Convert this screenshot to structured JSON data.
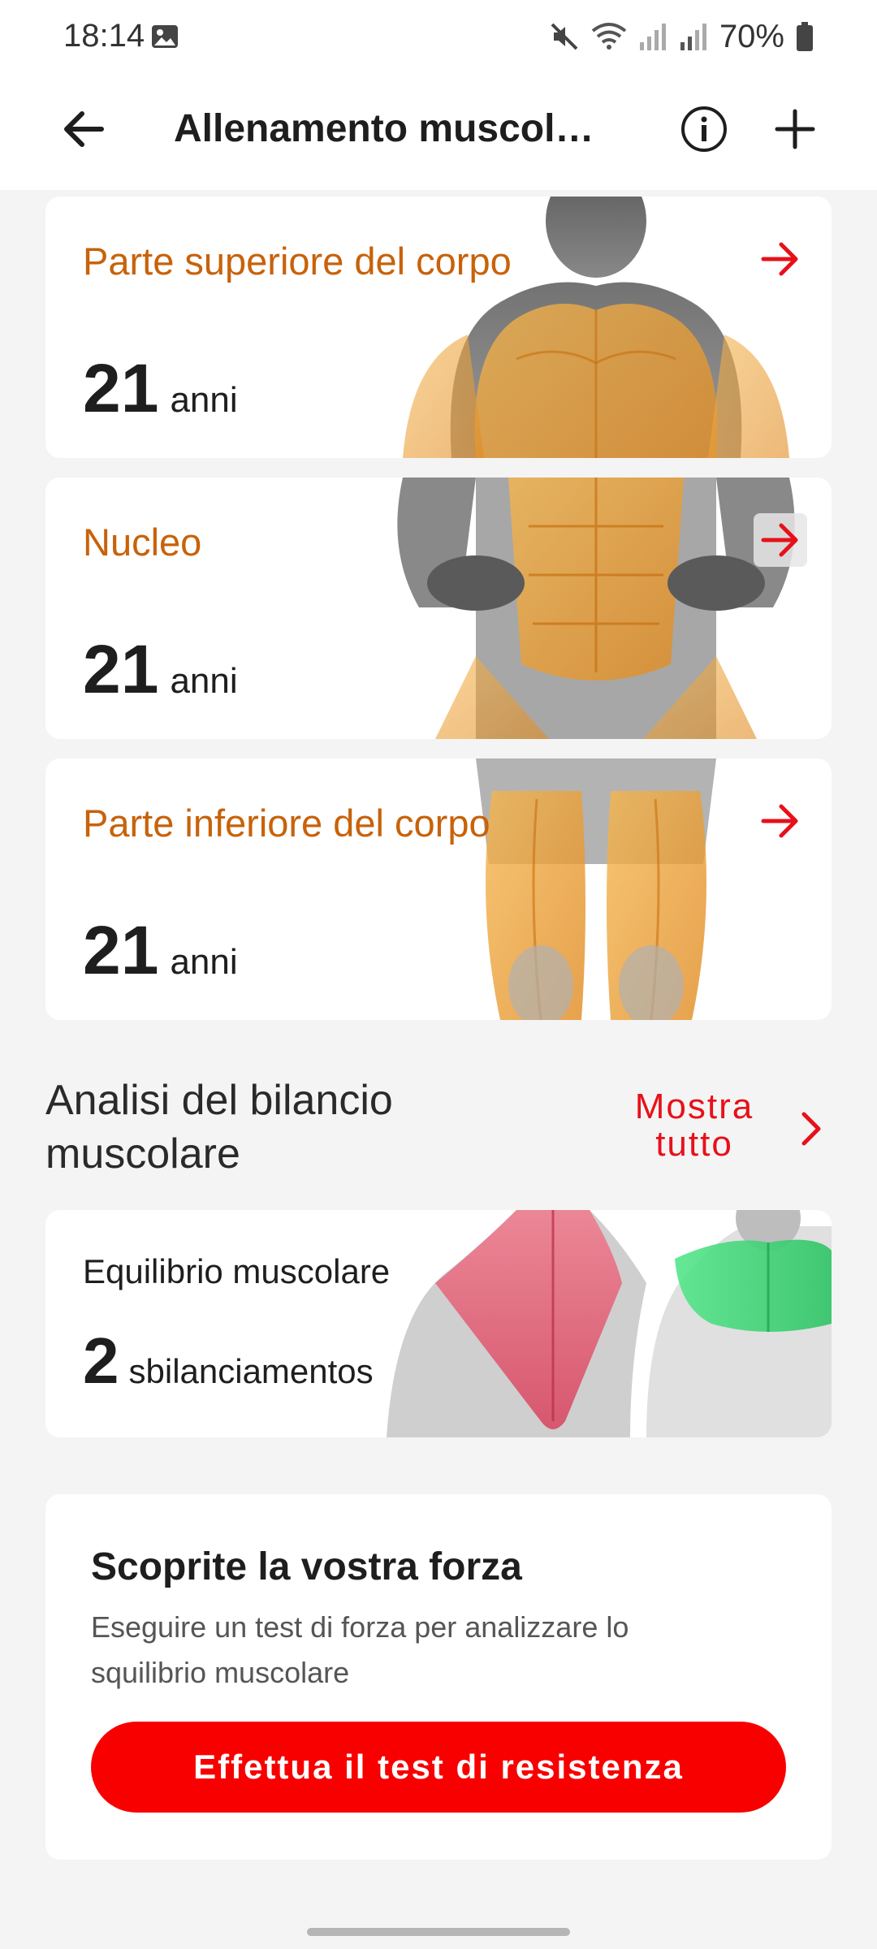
{
  "status_bar": {
    "time": "18:14",
    "battery": "70%",
    "icons": [
      "gallery-icon",
      "mute-icon",
      "wifi-icon",
      "signal-icon",
      "signal-icon",
      "battery-icon"
    ]
  },
  "app_bar": {
    "title": "Allenamento muscol…",
    "icons": [
      "back-arrow-icon",
      "info-icon",
      "plus-icon"
    ]
  },
  "regions": [
    {
      "title": "Parte superiore del corpo",
      "value": "21",
      "unit": "anni"
    },
    {
      "title": "Nucleo",
      "value": "21",
      "unit": "anni"
    },
    {
      "title": "Parte inferiore del corpo",
      "value": "21",
      "unit": "anni"
    }
  ],
  "balance_section": {
    "title": "Analisi del bilancio muscolare",
    "show_all": "Mostra tutto"
  },
  "balance_card": {
    "label": "Equilibrio muscolare",
    "value": "2",
    "unit": "sbilanciamentos"
  },
  "strength_card": {
    "title": "Scoprite la vostra forza",
    "description": "Eseguire un test di forza per analizzare lo squilibrio muscolare",
    "button": "Effettua il test di resistenza"
  },
  "colors": {
    "accent_red": "#e8101a",
    "button_red": "#f80000",
    "region_title_orange": "#c8620a",
    "background": "#f4f4f4"
  }
}
